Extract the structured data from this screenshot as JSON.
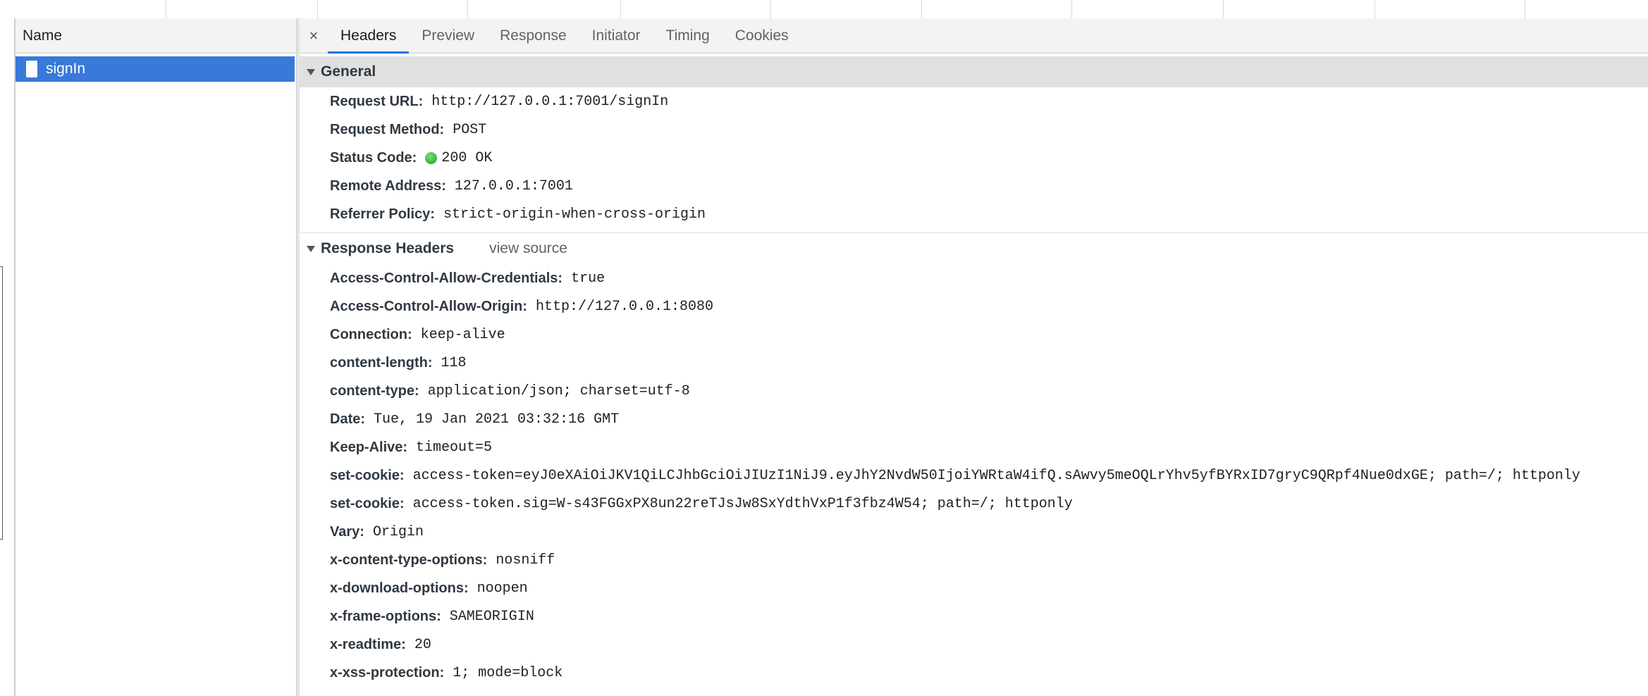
{
  "request_list": {
    "column_header": "Name",
    "selected_request": "signIn"
  },
  "tabs": {
    "close": "×",
    "items": [
      "Headers",
      "Preview",
      "Response",
      "Initiator",
      "Timing",
      "Cookies"
    ],
    "active": "Headers"
  },
  "general": {
    "title": "General",
    "rows": [
      {
        "key": "Request URL:",
        "value": "http://127.0.0.1:7001/signIn"
      },
      {
        "key": "Request Method:",
        "value": "POST"
      },
      {
        "key": "Status Code:",
        "value": "200 OK"
      },
      {
        "key": "Remote Address:",
        "value": "127.0.0.1:7001"
      },
      {
        "key": "Referrer Policy:",
        "value": "strict-origin-when-cross-origin"
      }
    ]
  },
  "response_headers": {
    "title": "Response Headers",
    "view_source": "view source",
    "rows": [
      {
        "key": "Access-Control-Allow-Credentials:",
        "value": "true"
      },
      {
        "key": "Access-Control-Allow-Origin:",
        "value": "http://127.0.0.1:8080"
      },
      {
        "key": "Connection:",
        "value": "keep-alive"
      },
      {
        "key": "content-length:",
        "value": "118"
      },
      {
        "key": "content-type:",
        "value": "application/json; charset=utf-8"
      },
      {
        "key": "Date:",
        "value": "Tue, 19 Jan 2021 03:32:16 GMT"
      },
      {
        "key": "Keep-Alive:",
        "value": "timeout=5"
      },
      {
        "key": "set-cookie:",
        "value": "access-token=eyJ0eXAiOiJKV1QiLCJhbGciOiJIUzI1NiJ9.eyJhY2NvdW50IjoiYWRtaW4ifQ.sAwvy5meOQLrYhv5yfBYRxID7gryC9QRpf4Nue0dxGE; path=/; httponly"
      },
      {
        "key": "set-cookie:",
        "value": "access-token.sig=W-s43FGGxPX8un22reTJsJw8SxYdthVxP1f3fbz4W54; path=/; httponly"
      },
      {
        "key": "Vary:",
        "value": "Origin"
      },
      {
        "key": "x-content-type-options:",
        "value": "nosniff"
      },
      {
        "key": "x-download-options:",
        "value": "noopen"
      },
      {
        "key": "x-frame-options:",
        "value": "SAMEORIGIN"
      },
      {
        "key": "x-readtime:",
        "value": "20"
      },
      {
        "key": "x-xss-protection:",
        "value": "1; mode=block"
      }
    ]
  },
  "colors": {
    "selection": "#3879d9",
    "active_tab_underline": "#1a73e8",
    "status_ok": "#1d9a1d"
  }
}
